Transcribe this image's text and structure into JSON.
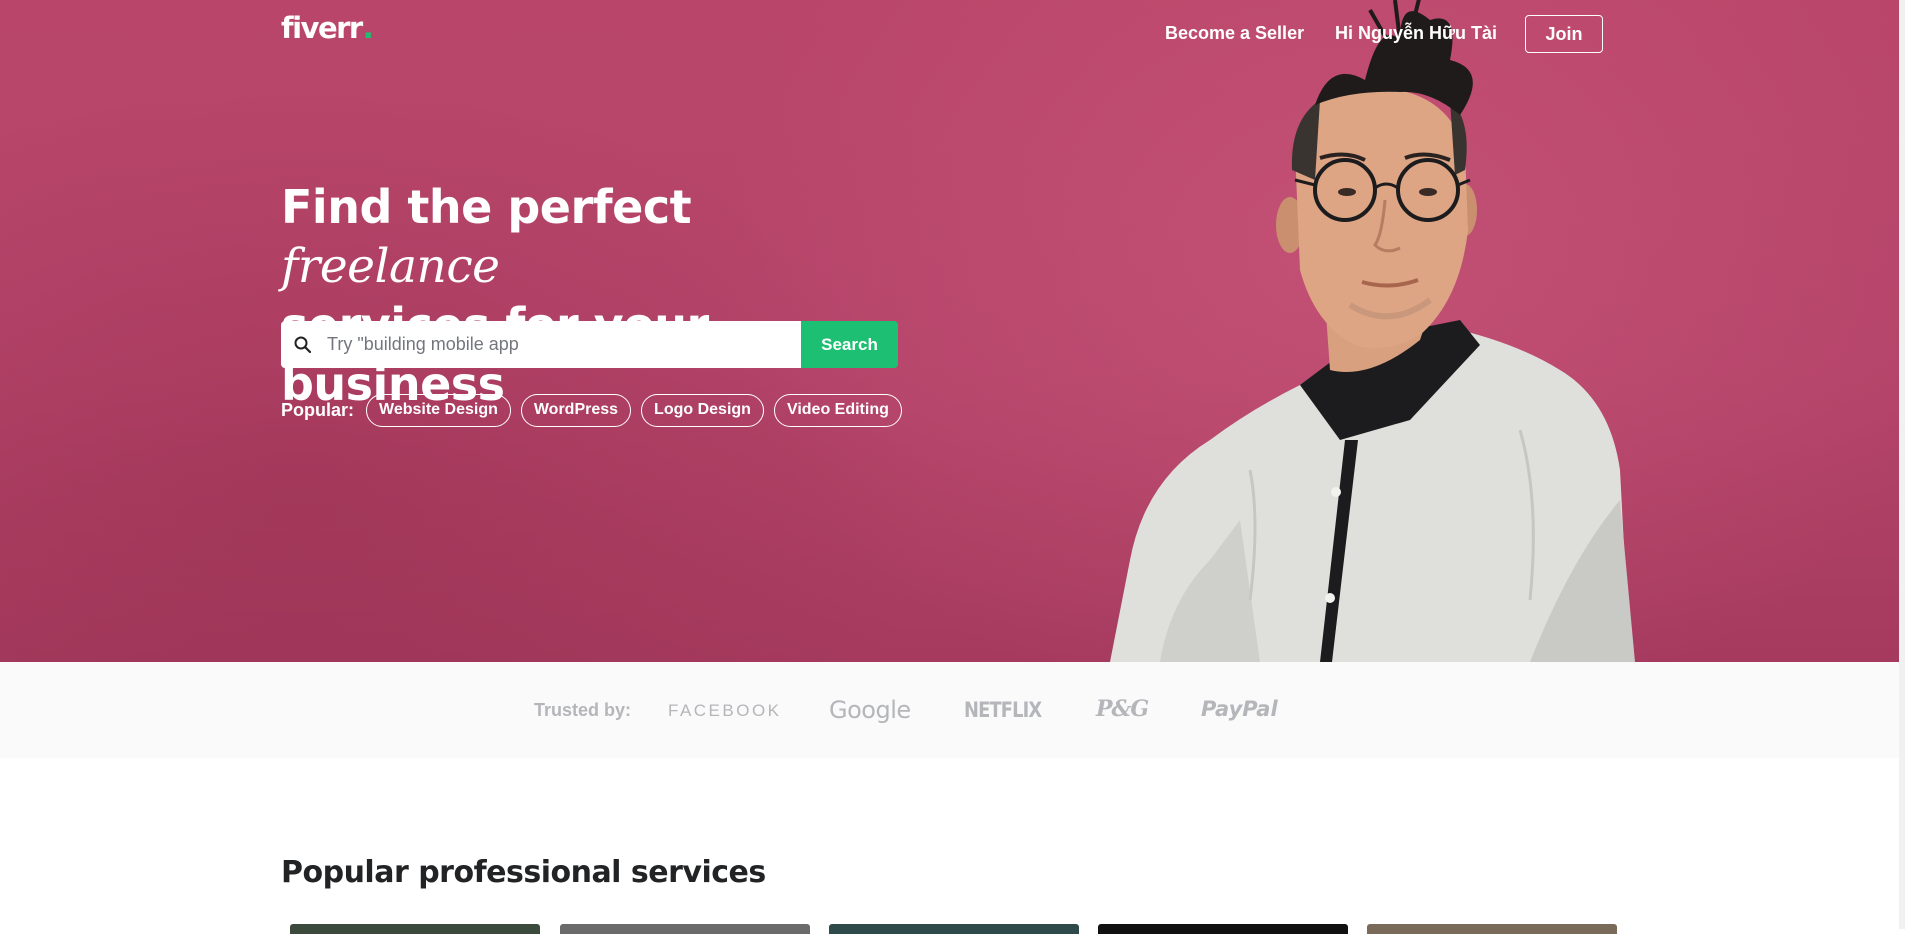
{
  "header": {
    "logo_text": "fiverr",
    "logo_dot": ".",
    "become_seller": "Become a Seller",
    "greeting": "Hi Nguyễn Hữu Tài",
    "join": "Join"
  },
  "hero": {
    "headline_part1": "Find the perfect ",
    "headline_italic": "freelance",
    "headline_part2": "services for your business",
    "search": {
      "placeholder": "Try \"building mobile app",
      "value": "",
      "button_label": "Search"
    },
    "popular_label": "Popular:",
    "popular_tags": [
      "Website Design",
      "WordPress",
      "Logo Design",
      "Video Editing"
    ]
  },
  "trusted": {
    "label": "Trusted by:",
    "brands": [
      "FACEBOOK",
      "Google",
      "NETFLIX",
      "P&G",
      "PayPal"
    ]
  },
  "services": {
    "title": "Popular professional services"
  },
  "colors": {
    "hero_background": "#b5446a",
    "brand_green": "#1dbf73",
    "trusted_background": "#fafafa",
    "brand_gray": "#b5b6ba",
    "heading_dark": "#222325"
  }
}
